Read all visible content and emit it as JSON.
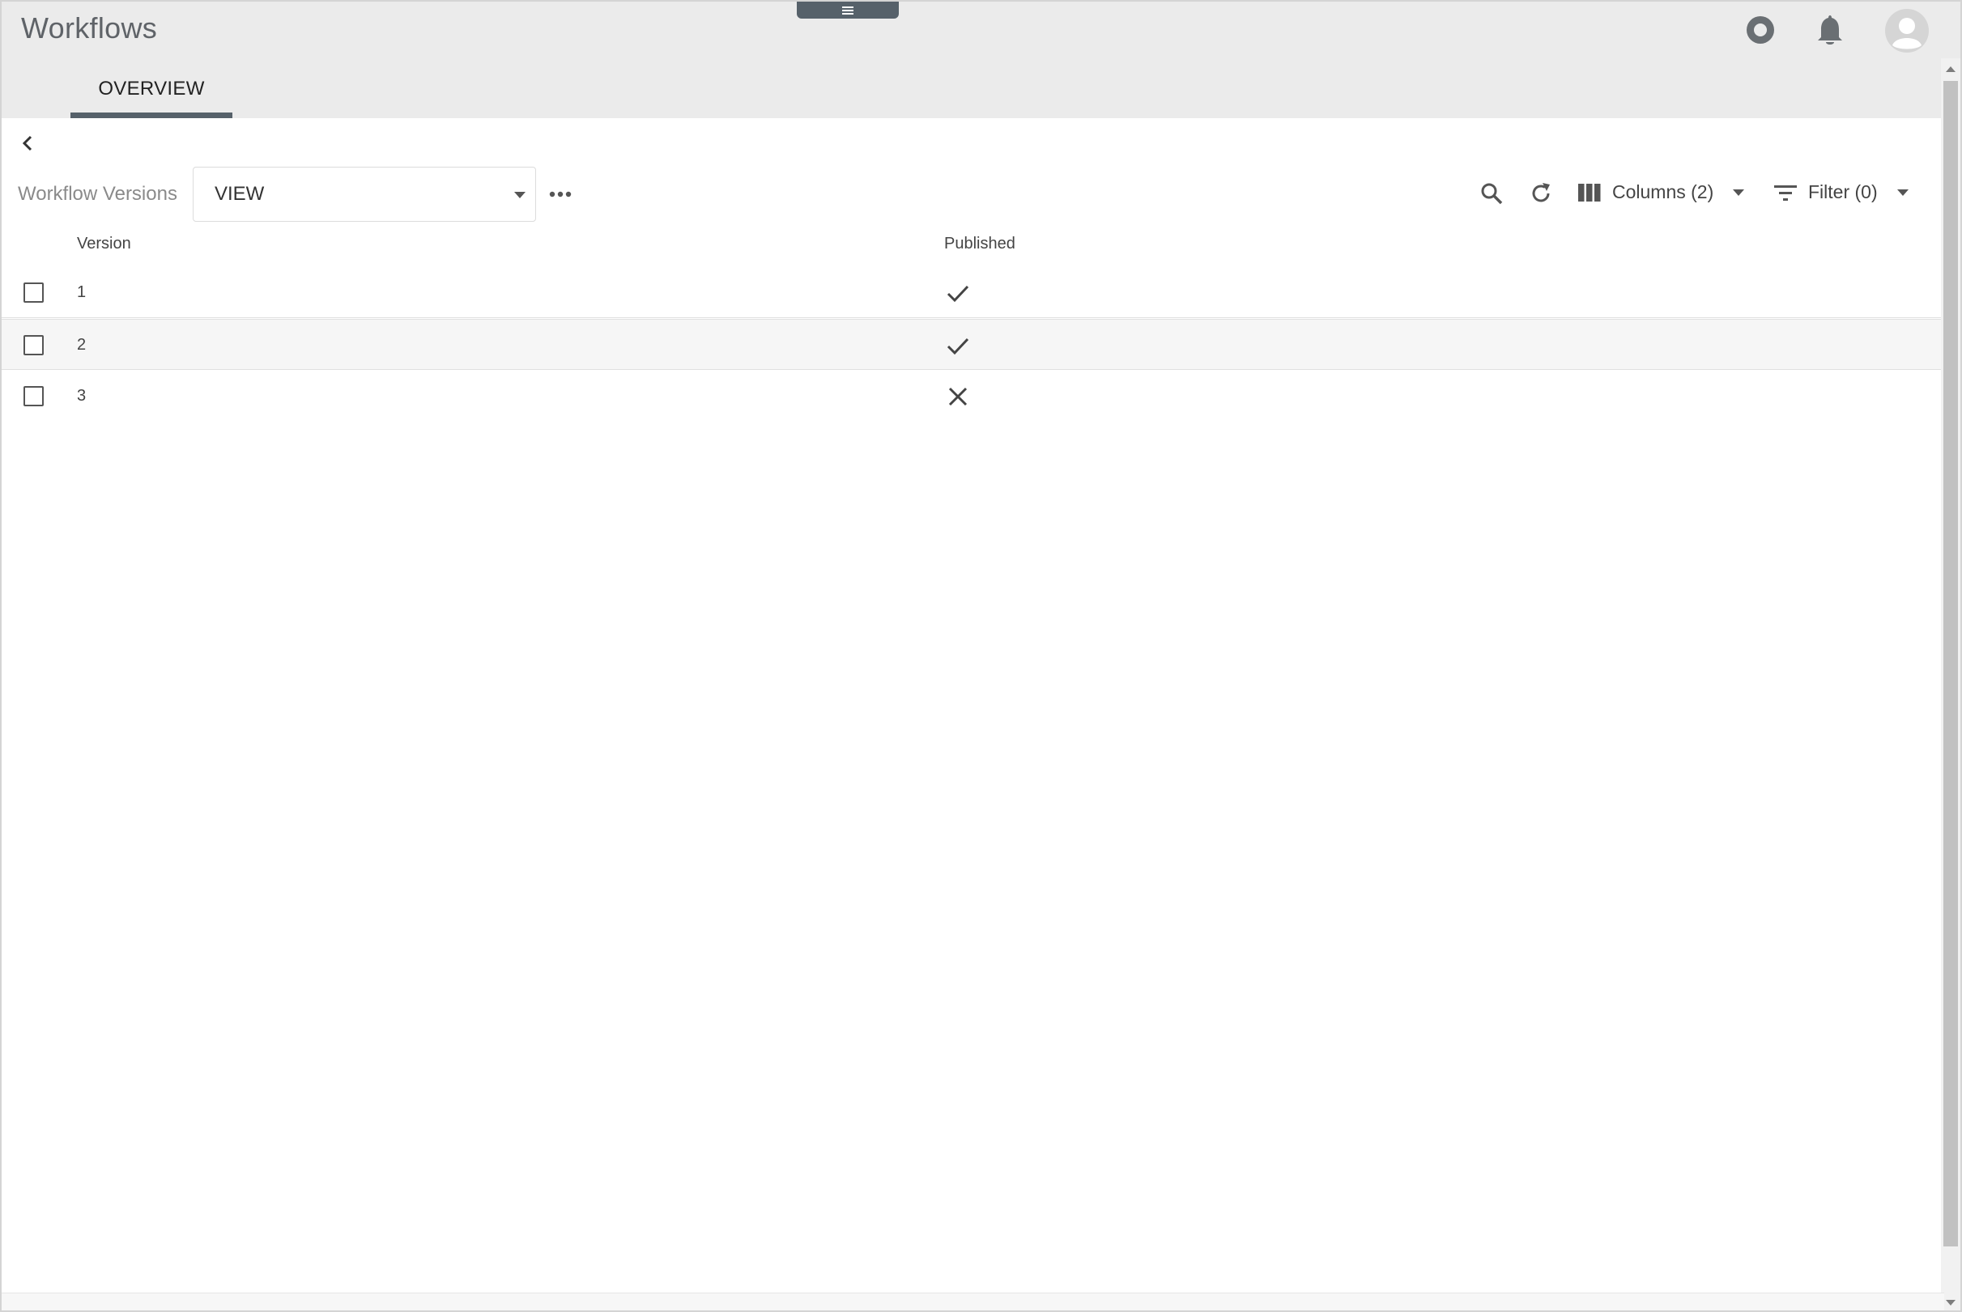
{
  "app": {
    "title": "Workflows"
  },
  "tabs": [
    {
      "label": "OVERVIEW",
      "active": true
    }
  ],
  "header_icons": [
    "record-icon",
    "bell-icon",
    "avatar-icon"
  ],
  "list": {
    "label": "Workflow Versions",
    "view_select": {
      "value": "VIEW"
    },
    "toolbar": {
      "columns_label": "Columns (2)",
      "filter_label": "Filter (0)"
    }
  },
  "table": {
    "columns": [
      "Version",
      "Published"
    ],
    "rows": [
      {
        "version": "1",
        "published": true
      },
      {
        "version": "2",
        "published": true
      },
      {
        "version": "3",
        "published": false
      }
    ]
  },
  "colors": {
    "header_bg": "#ebebeb",
    "accent": "#56616a",
    "row_alt": "#f6f6f6"
  }
}
